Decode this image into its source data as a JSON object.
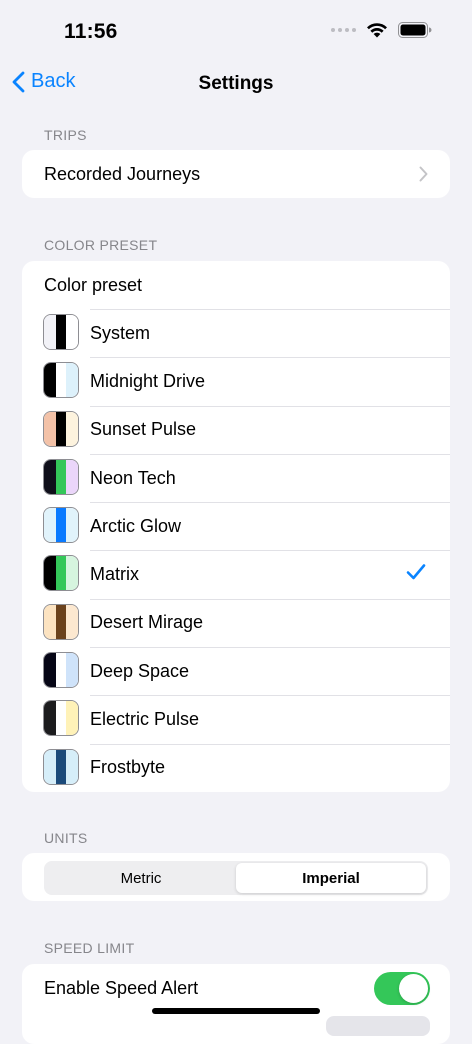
{
  "status_bar": {
    "time": "11:56"
  },
  "nav": {
    "back_label": "Back",
    "title": "Settings",
    "accent": "#0A84FF"
  },
  "trips": {
    "header": "TRIPS",
    "item_label": "Recorded Journeys"
  },
  "color_preset": {
    "header": "COLOR PRESET",
    "title": "Color preset",
    "selected": "Matrix",
    "presets": [
      {
        "name": "System",
        "colors": [
          "#F2F2F7",
          "#000000",
          "#FFFFFF"
        ]
      },
      {
        "name": "Midnight Drive",
        "colors": [
          "#000000",
          "#FFFFFF",
          "#DDF1FB"
        ]
      },
      {
        "name": "Sunset Pulse",
        "colors": [
          "#F3C2A8",
          "#000000",
          "#FDF3DE"
        ]
      },
      {
        "name": "Neon Tech",
        "colors": [
          "#0F0F1A",
          "#34C759",
          "#EBD6FA"
        ]
      },
      {
        "name": "Arctic Glow",
        "colors": [
          "#E1F3FB",
          "#0A7AFF",
          "#E1F3FB"
        ]
      },
      {
        "name": "Matrix",
        "colors": [
          "#000000",
          "#34C759",
          "#D6F5DF"
        ]
      },
      {
        "name": "Desert Mirage",
        "colors": [
          "#FCE3C1",
          "#6B421C",
          "#FCE8D0"
        ]
      },
      {
        "name": "Deep Space",
        "colors": [
          "#060616",
          "#FFFFFF",
          "#CFE3FA"
        ]
      },
      {
        "name": "Electric Pulse",
        "colors": [
          "#1C1C1E",
          "#FFFFFF",
          "#FFF2B8"
        ]
      },
      {
        "name": "Frostbyte",
        "colors": [
          "#D6EEF9",
          "#1B4A7A",
          "#D6EEF9"
        ]
      }
    ]
  },
  "units": {
    "header": "UNITS",
    "options": [
      "Metric",
      "Imperial"
    ],
    "selected": "Imperial"
  },
  "speed_limit": {
    "header": "SPEED LIMIT",
    "enable_label": "Enable Speed Alert",
    "enabled": true,
    "toggle_color": "#34C759"
  }
}
